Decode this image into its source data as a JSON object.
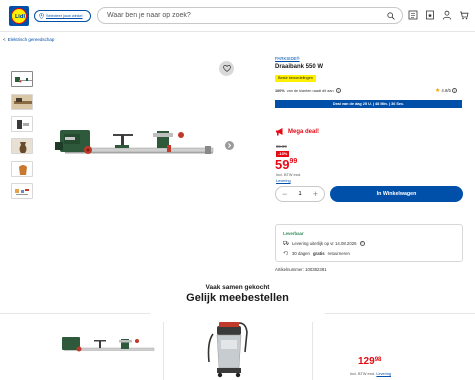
{
  "header": {
    "logo_text": "Lidl",
    "store_label": "Selecteer jouw winkel",
    "search_placeholder": "Waar ben je naar op zoek?"
  },
  "breadcrumb": {
    "separator": "<",
    "label": "Elektrisch gereedschap"
  },
  "product": {
    "brand": "PARKSIDE®",
    "title": "Draaibank 550 W",
    "badge": "Beste beoordelingen",
    "recommend_bold": "100%",
    "recommend_text": "van de klanten raadt dit aan",
    "rating_value": "4.8/5",
    "deal_bar": "Deal van de dag 25 U. | 48 Min. | 36 Sec.",
    "mega_deal": "Mega deal!",
    "old_price": "69.99",
    "discount": "-13%",
    "price": "59.99",
    "price_int": "59",
    "price_dec": "99",
    "vat": "Incl. BTW excl.",
    "delivery_link": "Levering",
    "quantity": "1",
    "cart_button": "In Winkelwagen",
    "delivery": {
      "status": "Leverbaar",
      "line1": "Levering uiterlijk op vr 14.08.2026",
      "line2_pre": "30 dagen",
      "line2_bold": "gratis",
      "line2_post": "retourneren"
    },
    "article_number": "Artikelnummer: 100382381"
  },
  "recommendations": {
    "subtitle": "Vaak samen gekocht",
    "title": "Gelijk meebestellen",
    "price_int": "129",
    "price_dec": "98",
    "vat_text": "Incl. BTW excl.",
    "vat_link": "Levering"
  },
  "colors": {
    "brand_blue": "#0050aa",
    "deal_red": "#e60a14",
    "badge_yellow": "#fff000",
    "available_green": "#2e8b57"
  }
}
